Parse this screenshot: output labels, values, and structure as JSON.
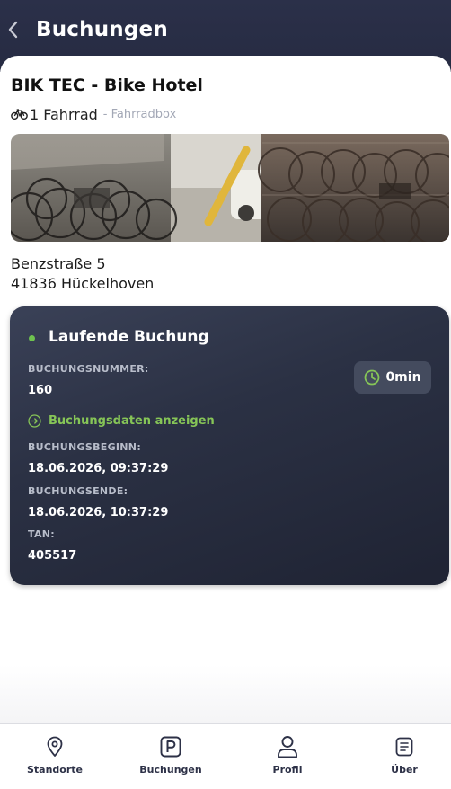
{
  "header": {
    "title": "Buchungen"
  },
  "venue": {
    "name": "BIK TEC - Bike Hotel",
    "capacity": "1 Fahrrad",
    "type": "- Fahrradbox",
    "street": "Benzstraße 5",
    "city": "41836 Hückelhoven"
  },
  "booking": {
    "status_title": "Laufende Buchung",
    "number_label": "BUCHUNGSNUMMER:",
    "number_value": "160",
    "timer": "0min",
    "details_link": "Buchungsdaten anzeigen",
    "start_label": "BUCHUNGSBEGINN:",
    "start_value": "18.06.2026, 09:37:29",
    "end_label": "BUCHUNGSENDE:",
    "end_value": "18.06.2026, 10:37:29",
    "tan_label": "TAN:",
    "tan_value": "405517"
  },
  "tabs": [
    {
      "label": "Standorte",
      "icon": "map-pin-icon"
    },
    {
      "label": "Buchungen",
      "icon": "parking-icon"
    },
    {
      "label": "Profil",
      "icon": "user-icon"
    },
    {
      "label": "Über",
      "icon": "info-document-icon"
    }
  ],
  "colors": {
    "header_bg": "#2b3049",
    "accent_green": "#86c557",
    "card_bg": "#2b3144",
    "tab_text": "#2d3147"
  }
}
